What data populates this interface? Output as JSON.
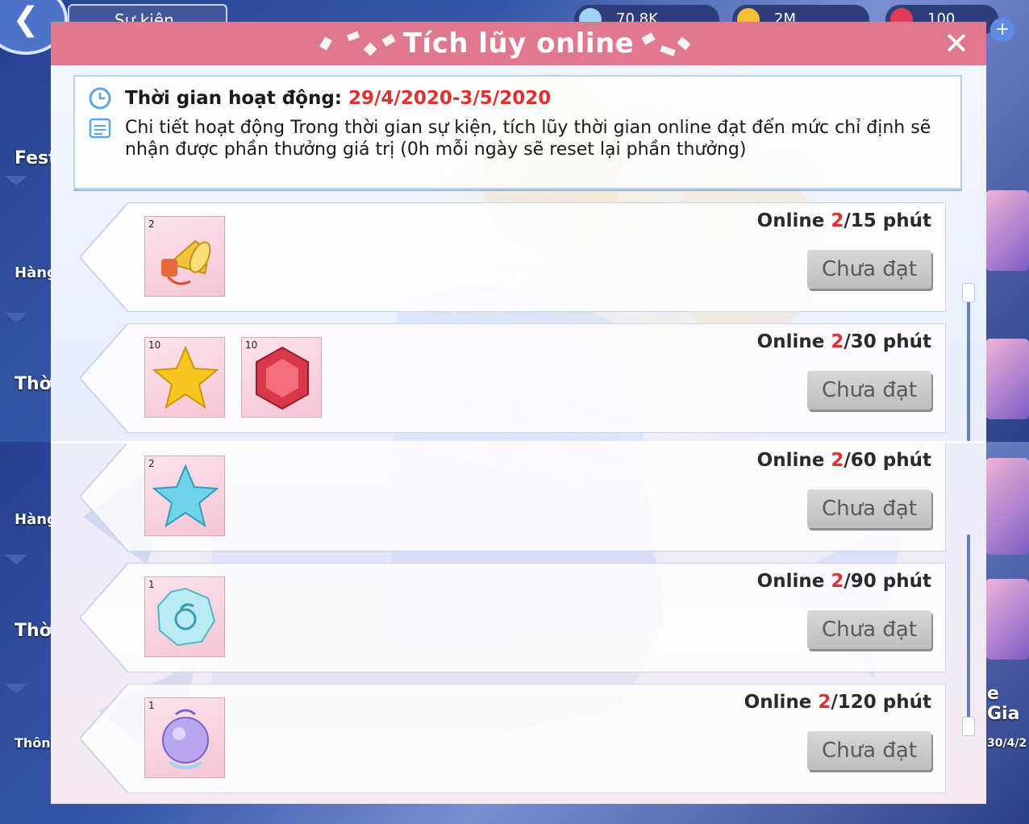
{
  "background": {
    "top_tab": "Sự kiện",
    "resources": [
      {
        "value": "70.8K",
        "icon": "diamond-icon"
      },
      {
        "value": "2M",
        "icon": "coin-icon"
      },
      {
        "value": "100",
        "icon": "heart-icon"
      }
    ],
    "side_labels": [
      "Fest",
      "Hàng",
      "Thời",
      "Hàng",
      "Thời",
      "Thông"
    ],
    "right_text": [
      "e Gia",
      "30/4/2"
    ]
  },
  "dialog": {
    "title": "Tích lũy online",
    "info": {
      "time_label": "Thời gian hoạt động: ",
      "time_value": "29/4/2020-3/5/2020",
      "detail": "Chi tiết hoạt động Trong thời gian sự kiện, tích lũy thời gian online đạt đến mức chỉ định sẽ nhận được phần thưởng giá trị (0h mỗi ngày sẽ reset lại phần thưởng)"
    },
    "rows": [
      {
        "prefix": "Online ",
        "current": "2",
        "suffix": "/15 phút",
        "button": "Chưa đạt",
        "items": [
          {
            "qty": "2",
            "icon": "horn-icon"
          }
        ]
      },
      {
        "prefix": "Online ",
        "current": "2",
        "suffix": "/30 phút",
        "button": "Chưa đạt",
        "items": [
          {
            "qty": "10",
            "icon": "gold-star-icon"
          },
          {
            "qty": "10",
            "icon": "red-gem-icon"
          }
        ]
      },
      {
        "prefix": "Online ",
        "current": "2",
        "suffix": "/60 phút",
        "button": "Chưa đạt",
        "items": [
          {
            "qty": "2",
            "icon": "blue-star-icon"
          }
        ]
      },
      {
        "prefix": "Online ",
        "current": "2",
        "suffix": "/90 phút",
        "button": "Chưa đạt",
        "items": [
          {
            "qty": "1",
            "icon": "crystal-badge-icon"
          }
        ]
      },
      {
        "prefix": "Online ",
        "current": "2",
        "suffix": "/120 phút",
        "button": "Chưa đạt",
        "items": [
          {
            "qty": "1",
            "icon": "crystal-ball-icon"
          }
        ]
      }
    ]
  },
  "colors": {
    "header": "#e07890",
    "highlight": "#e0312f",
    "button": "#c9c9c9"
  }
}
